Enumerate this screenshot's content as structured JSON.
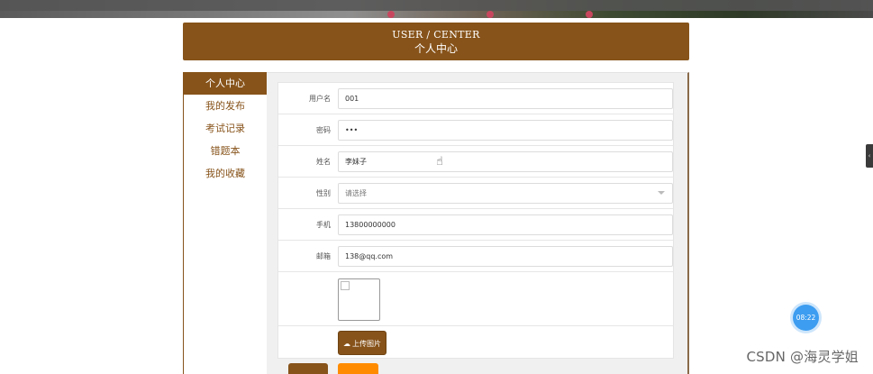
{
  "header": {
    "title_en": "USER / CENTER",
    "title_cn": "个人中心"
  },
  "sidebar": {
    "items": [
      {
        "label": "个人中心",
        "active": true
      },
      {
        "label": "我的发布",
        "active": false
      },
      {
        "label": "考试记录",
        "active": false
      },
      {
        "label": "错题本",
        "active": false
      },
      {
        "label": "我的收藏",
        "active": false
      }
    ]
  },
  "form": {
    "username": {
      "label": "用户名",
      "value": "001"
    },
    "password": {
      "label": "密码",
      "value": "•••"
    },
    "name": {
      "label": "姓名",
      "value": "李妹子"
    },
    "gender": {
      "label": "性别",
      "value": "请选择"
    },
    "phone": {
      "label": "手机",
      "value": "13800000000"
    },
    "email": {
      "label": "邮箱",
      "value": "138@qq.com"
    },
    "upload_label": "上传图片"
  },
  "clock": {
    "time": "08:22"
  },
  "watermark": "CSDN @海灵学姐",
  "icons": {
    "upload": "cloud-upload-icon",
    "cursor": "hand-pointer-icon",
    "edge": "chevron-left-icon"
  },
  "colors": {
    "brand": "#87531a",
    "accent": "#ff8c00",
    "badge": "#3d9df0"
  }
}
